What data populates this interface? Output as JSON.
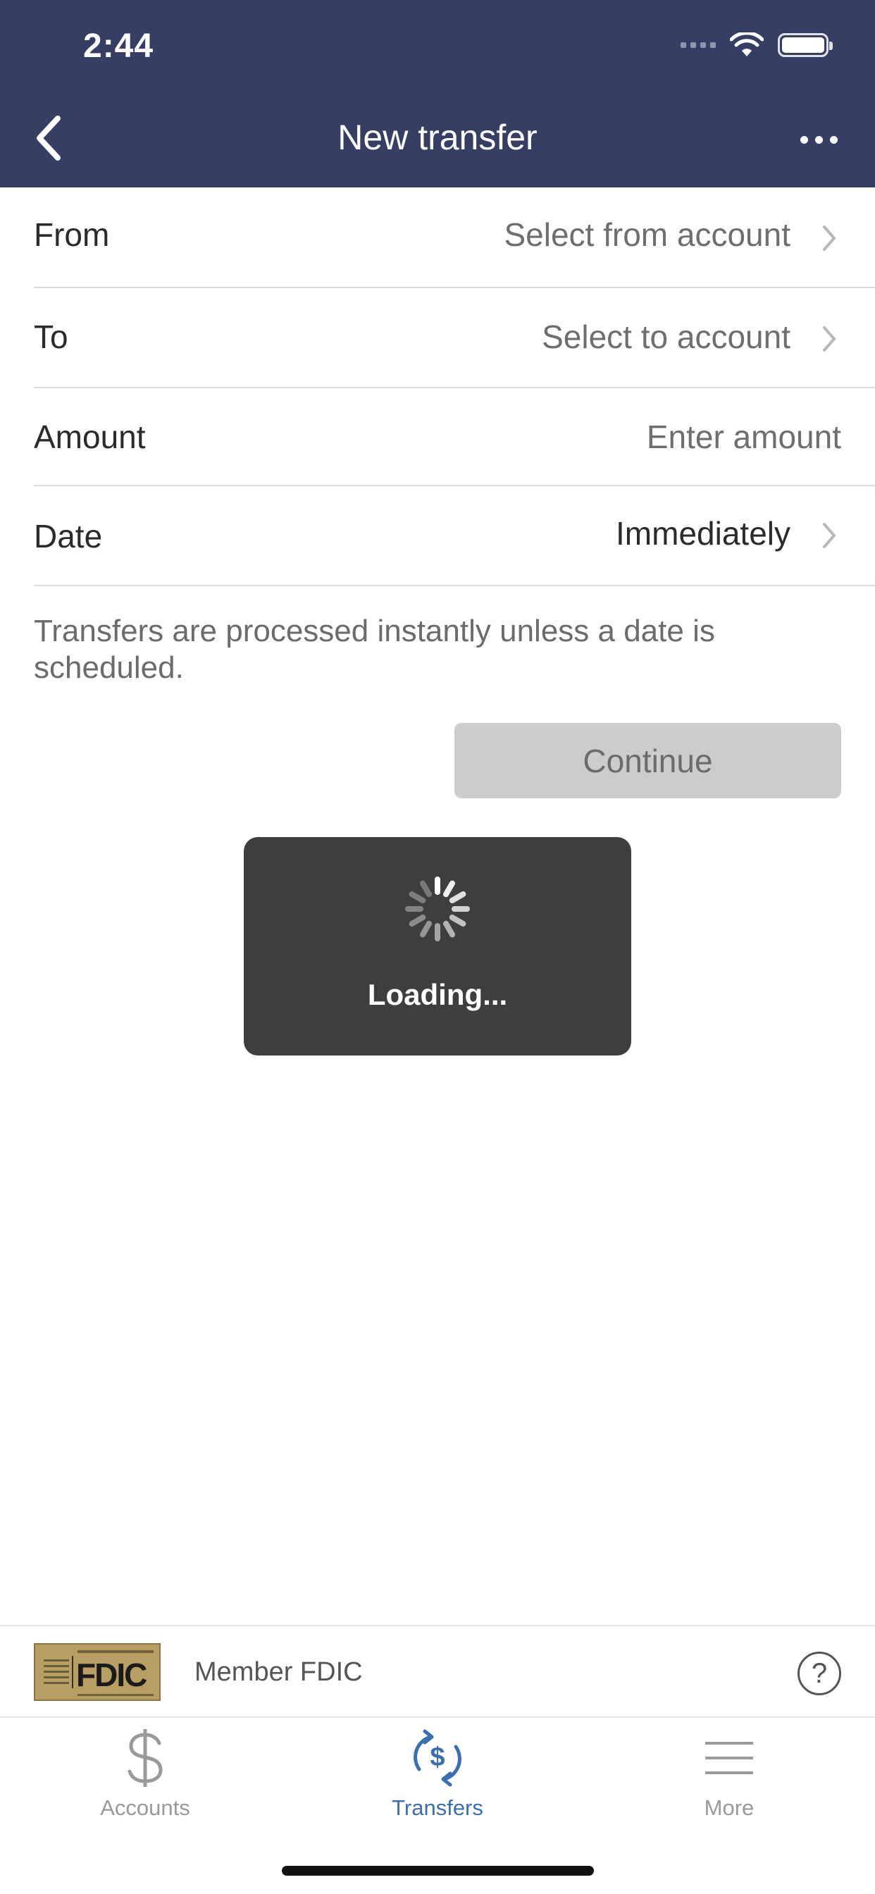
{
  "status_bar": {
    "time": "2:44"
  },
  "header": {
    "title": "New transfer"
  },
  "form": {
    "rows": [
      {
        "label": "From",
        "value": "Select from account"
      },
      {
        "label": "To",
        "value": "Select to account"
      },
      {
        "label": "Amount",
        "placeholder": "Enter amount"
      },
      {
        "label": "Date",
        "value": "Immediately"
      }
    ],
    "info": "Transfers are processed instantly unless a date is scheduled.",
    "continue_label": "Continue"
  },
  "loading": {
    "text": "Loading..."
  },
  "footer": {
    "fdic_logo_text": "FDIC",
    "member_text": "Member FDIC",
    "help_symbol": "?"
  },
  "tabs": [
    {
      "label": "Accounts",
      "icon": "dollar-icon",
      "active": false
    },
    {
      "label": "Transfers",
      "icon": "transfer-dollar-icon",
      "active": true
    },
    {
      "label": "More",
      "icon": "menu-lines-icon",
      "active": false
    }
  ],
  "colors": {
    "header_bg": "#363f63",
    "active_tab": "#3a6fb0",
    "inactive_tab": "#9a9a9a",
    "button_disabled": "#cccccc",
    "loading_bg": "#3e3e3e"
  }
}
